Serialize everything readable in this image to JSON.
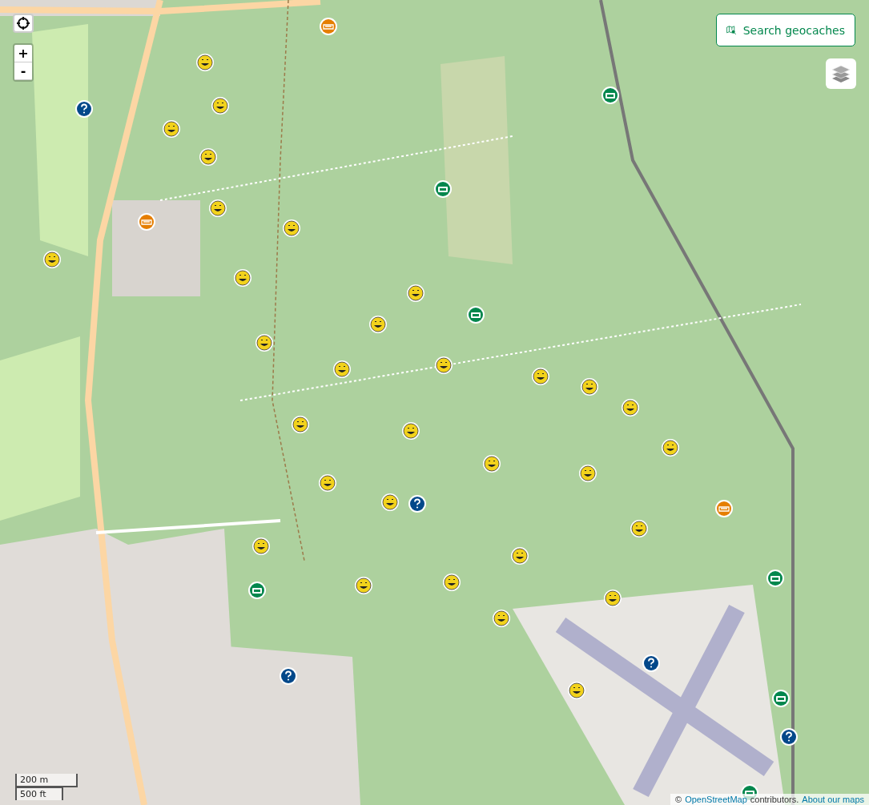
{
  "zoom_controls": {
    "zoom_in": "+",
    "zoom_out": "-"
  },
  "search_button": {
    "label": "Search geocaches"
  },
  "markers": [
    {
      "kind": "event"
    },
    {
      "kind": "traditional"
    },
    {
      "kind": "traditional"
    },
    {
      "kind": "mystery"
    },
    {
      "kind": "traditional"
    },
    {
      "kind": "multi"
    },
    {
      "kind": "traditional"
    },
    {
      "kind": "multi"
    },
    {
      "kind": "traditional"
    },
    {
      "kind": "event"
    },
    {
      "kind": "traditional"
    },
    {
      "kind": "traditional"
    },
    {
      "kind": "traditional"
    },
    {
      "kind": "traditional"
    },
    {
      "kind": "multi"
    },
    {
      "kind": "traditional"
    },
    {
      "kind": "traditional"
    },
    {
      "kind": "traditional"
    },
    {
      "kind": "traditional"
    },
    {
      "kind": "traditional"
    },
    {
      "kind": "traditional"
    },
    {
      "kind": "traditional"
    },
    {
      "kind": "traditional"
    },
    {
      "kind": "traditional"
    },
    {
      "kind": "traditional"
    },
    {
      "kind": "traditional"
    },
    {
      "kind": "traditional"
    },
    {
      "kind": "traditional"
    },
    {
      "kind": "traditional"
    },
    {
      "kind": "traditional"
    },
    {
      "kind": "mystery"
    },
    {
      "kind": "event"
    },
    {
      "kind": "traditional"
    },
    {
      "kind": "traditional"
    },
    {
      "kind": "traditional"
    },
    {
      "kind": "multi"
    },
    {
      "kind": "traditional"
    },
    {
      "kind": "traditional"
    },
    {
      "kind": "traditional"
    },
    {
      "kind": "traditional"
    },
    {
      "kind": "mystery"
    },
    {
      "kind": "mystery"
    },
    {
      "kind": "multi"
    },
    {
      "kind": "multi"
    },
    {
      "kind": "mystery"
    },
    {
      "kind": "multi"
    }
  ],
  "scale": {
    "metric": "200 m",
    "imperial": "500 ft"
  },
  "attribution": {
    "prefix": "©",
    "link": "OpenStreetMap",
    "middle": "contributors.",
    "about_link": "About our maps"
  }
}
